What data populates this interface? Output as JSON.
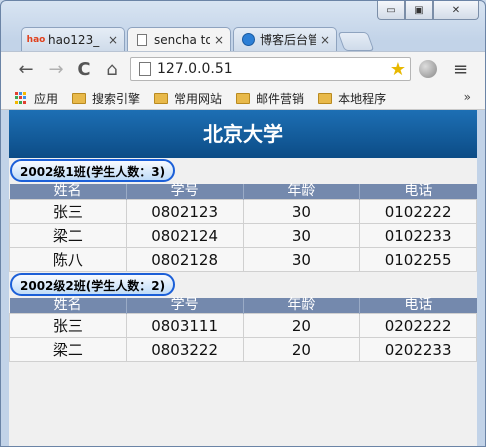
{
  "window_controls": {
    "min_label": "▭",
    "max_label": "▣",
    "close_label": "✕"
  },
  "tabs": [
    {
      "title": "hao123_",
      "favicon": "hao123-logo-icon",
      "favicon_text": "hao",
      "close": "×",
      "active": false
    },
    {
      "title": "sencha to",
      "favicon": "page-icon",
      "close": "×",
      "active": true
    },
    {
      "title": "博客后台管",
      "favicon": "blog-logo-icon",
      "close": "×",
      "active": false
    }
  ],
  "toolbar": {
    "back_icon": "←",
    "forward_icon": "→",
    "reload_icon": "C",
    "home_icon": "⌂",
    "url": "127.0.0.51",
    "star_icon": "★",
    "menu_icon": "≡"
  },
  "bookmarks": {
    "apps_label": "应用",
    "items": [
      "搜索引擎",
      "常用网站",
      "邮件营销",
      "本地程序"
    ],
    "more": "»"
  },
  "page": {
    "header_title": "北京大学",
    "columns": [
      "姓名",
      "学号",
      "年龄",
      "电话"
    ],
    "groups": [
      {
        "label": "2002级1班(学生人数：3)",
        "rows": [
          [
            "张三",
            "0802123",
            "30",
            "0102222"
          ],
          [
            "梁二",
            "0802124",
            "30",
            "0102233"
          ],
          [
            "陈八",
            "0802128",
            "30",
            "0102255"
          ]
        ]
      },
      {
        "label": "2002级2班(学生人数：2)",
        "rows": [
          [
            "张三",
            "0803111",
            "20",
            "0202222"
          ],
          [
            "梁二",
            "0803222",
            "20",
            "0202233"
          ]
        ]
      }
    ]
  },
  "colors": {
    "header": "#0c4c86",
    "group_border": "#1b5fd8",
    "column_header": "#7489ad"
  }
}
